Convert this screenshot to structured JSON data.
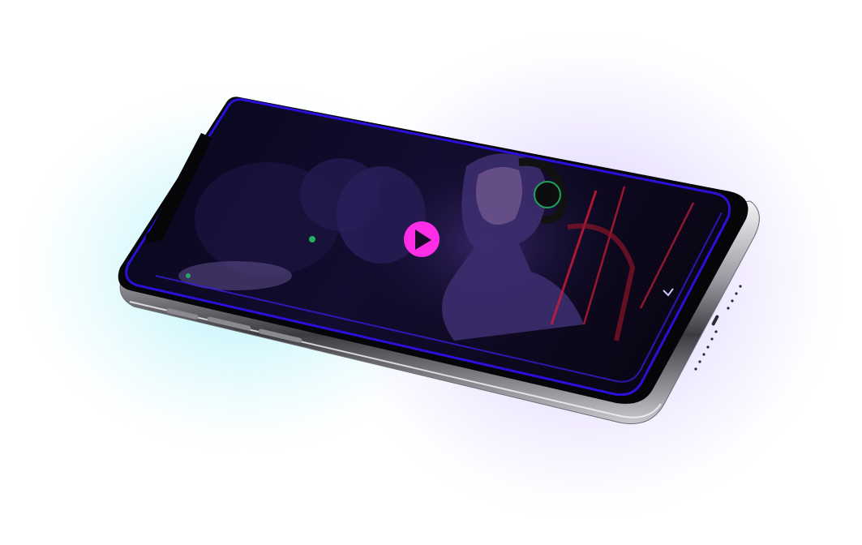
{
  "scene": {
    "subject": "phone-mockup",
    "screen_content": "gaming-video-still",
    "accent_color": "#2a10d8",
    "play_button_color": "#ff2ee6",
    "icons": {
      "play": "play-icon",
      "corner_arrow": "chevron-icon"
    }
  }
}
